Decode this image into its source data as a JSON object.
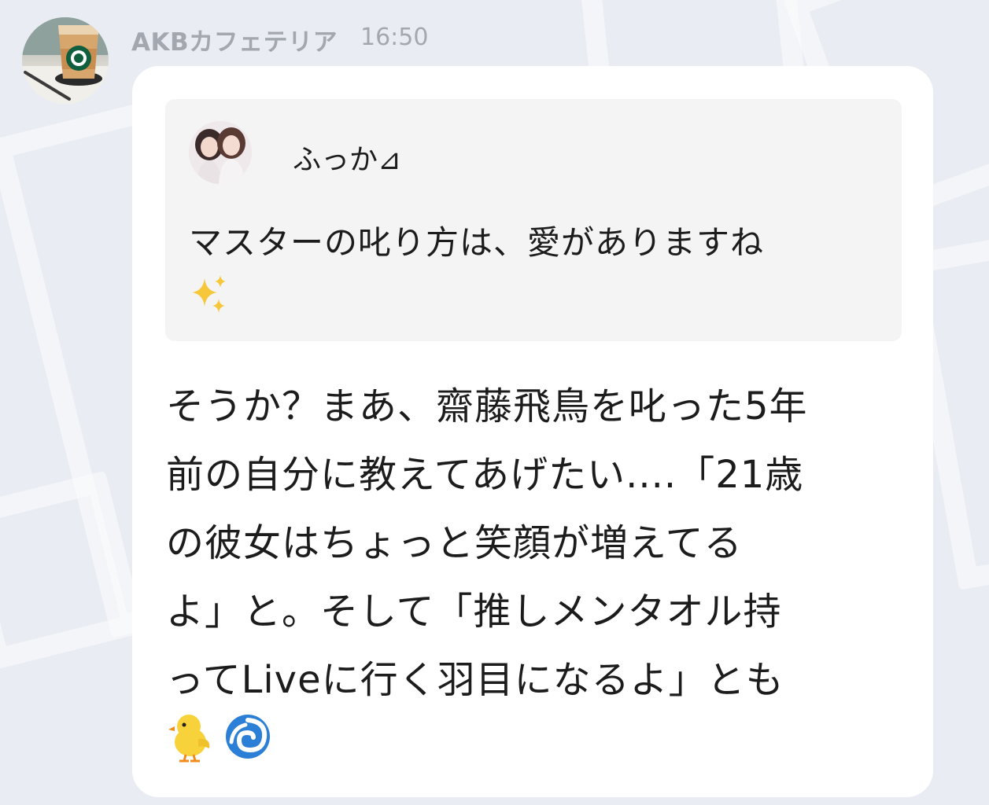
{
  "message": {
    "sender_name": "AKBカフェテリア",
    "time": "16:50",
    "sender_avatar_icon": "coffee-cup-avatar",
    "quote": {
      "author_name": "ふっか⊿",
      "author_avatar_icon": "two-girls-avatar",
      "text": "マスターの叱り方は、愛がありますね",
      "emoji": "sparkles"
    },
    "body_lines": [
      "そうか？まあ、齋藤飛鳥を叱った5年",
      "前の自分に教えてあげたい....「21歳",
      "の彼女はちょっと笑顔が増えてる",
      "よ」と。そして「推しメンタオル持",
      "ってLiveに行く羽目になるよ」とも"
    ],
    "trailing_emojis": [
      "baby-chick",
      "cyclone"
    ]
  },
  "colors": {
    "background": "#e9edf3",
    "bubble": "#ffffff",
    "quote_background": "#f4f4f4",
    "meta_text": "#a3a8b0",
    "body_text": "#1c1c1c"
  }
}
